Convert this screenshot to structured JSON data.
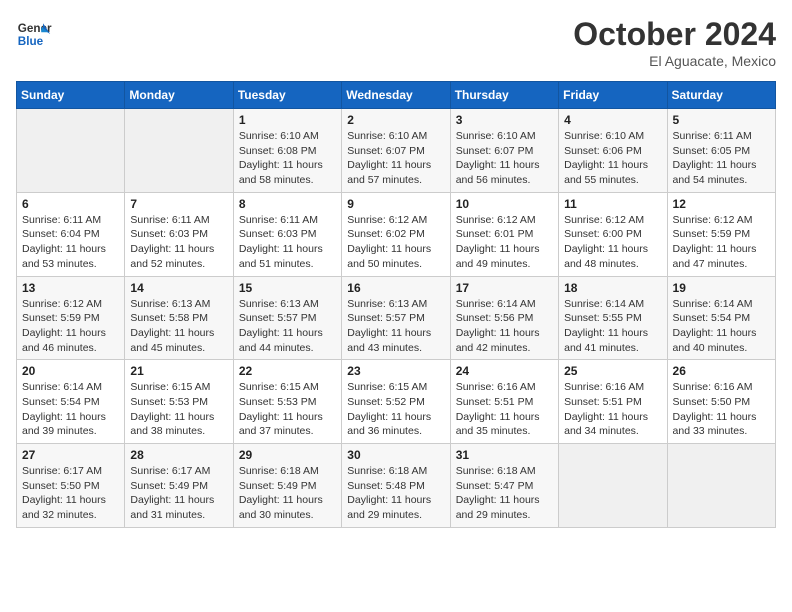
{
  "header": {
    "logo_line1": "General",
    "logo_line2": "Blue",
    "month": "October 2024",
    "location": "El Aguacate, Mexico"
  },
  "weekdays": [
    "Sunday",
    "Monday",
    "Tuesday",
    "Wednesday",
    "Thursday",
    "Friday",
    "Saturday"
  ],
  "weeks": [
    [
      {
        "day": "",
        "sunrise": "",
        "sunset": "",
        "daylight": ""
      },
      {
        "day": "",
        "sunrise": "",
        "sunset": "",
        "daylight": ""
      },
      {
        "day": "1",
        "sunrise": "Sunrise: 6:10 AM",
        "sunset": "Sunset: 6:08 PM",
        "daylight": "Daylight: 11 hours and 58 minutes."
      },
      {
        "day": "2",
        "sunrise": "Sunrise: 6:10 AM",
        "sunset": "Sunset: 6:07 PM",
        "daylight": "Daylight: 11 hours and 57 minutes."
      },
      {
        "day": "3",
        "sunrise": "Sunrise: 6:10 AM",
        "sunset": "Sunset: 6:07 PM",
        "daylight": "Daylight: 11 hours and 56 minutes."
      },
      {
        "day": "4",
        "sunrise": "Sunrise: 6:10 AM",
        "sunset": "Sunset: 6:06 PM",
        "daylight": "Daylight: 11 hours and 55 minutes."
      },
      {
        "day": "5",
        "sunrise": "Sunrise: 6:11 AM",
        "sunset": "Sunset: 6:05 PM",
        "daylight": "Daylight: 11 hours and 54 minutes."
      }
    ],
    [
      {
        "day": "6",
        "sunrise": "Sunrise: 6:11 AM",
        "sunset": "Sunset: 6:04 PM",
        "daylight": "Daylight: 11 hours and 53 minutes."
      },
      {
        "day": "7",
        "sunrise": "Sunrise: 6:11 AM",
        "sunset": "Sunset: 6:03 PM",
        "daylight": "Daylight: 11 hours and 52 minutes."
      },
      {
        "day": "8",
        "sunrise": "Sunrise: 6:11 AM",
        "sunset": "Sunset: 6:03 PM",
        "daylight": "Daylight: 11 hours and 51 minutes."
      },
      {
        "day": "9",
        "sunrise": "Sunrise: 6:12 AM",
        "sunset": "Sunset: 6:02 PM",
        "daylight": "Daylight: 11 hours and 50 minutes."
      },
      {
        "day": "10",
        "sunrise": "Sunrise: 6:12 AM",
        "sunset": "Sunset: 6:01 PM",
        "daylight": "Daylight: 11 hours and 49 minutes."
      },
      {
        "day": "11",
        "sunrise": "Sunrise: 6:12 AM",
        "sunset": "Sunset: 6:00 PM",
        "daylight": "Daylight: 11 hours and 48 minutes."
      },
      {
        "day": "12",
        "sunrise": "Sunrise: 6:12 AM",
        "sunset": "Sunset: 5:59 PM",
        "daylight": "Daylight: 11 hours and 47 minutes."
      }
    ],
    [
      {
        "day": "13",
        "sunrise": "Sunrise: 6:12 AM",
        "sunset": "Sunset: 5:59 PM",
        "daylight": "Daylight: 11 hours and 46 minutes."
      },
      {
        "day": "14",
        "sunrise": "Sunrise: 6:13 AM",
        "sunset": "Sunset: 5:58 PM",
        "daylight": "Daylight: 11 hours and 45 minutes."
      },
      {
        "day": "15",
        "sunrise": "Sunrise: 6:13 AM",
        "sunset": "Sunset: 5:57 PM",
        "daylight": "Daylight: 11 hours and 44 minutes."
      },
      {
        "day": "16",
        "sunrise": "Sunrise: 6:13 AM",
        "sunset": "Sunset: 5:57 PM",
        "daylight": "Daylight: 11 hours and 43 minutes."
      },
      {
        "day": "17",
        "sunrise": "Sunrise: 6:14 AM",
        "sunset": "Sunset: 5:56 PM",
        "daylight": "Daylight: 11 hours and 42 minutes."
      },
      {
        "day": "18",
        "sunrise": "Sunrise: 6:14 AM",
        "sunset": "Sunset: 5:55 PM",
        "daylight": "Daylight: 11 hours and 41 minutes."
      },
      {
        "day": "19",
        "sunrise": "Sunrise: 6:14 AM",
        "sunset": "Sunset: 5:54 PM",
        "daylight": "Daylight: 11 hours and 40 minutes."
      }
    ],
    [
      {
        "day": "20",
        "sunrise": "Sunrise: 6:14 AM",
        "sunset": "Sunset: 5:54 PM",
        "daylight": "Daylight: 11 hours and 39 minutes."
      },
      {
        "day": "21",
        "sunrise": "Sunrise: 6:15 AM",
        "sunset": "Sunset: 5:53 PM",
        "daylight": "Daylight: 11 hours and 38 minutes."
      },
      {
        "day": "22",
        "sunrise": "Sunrise: 6:15 AM",
        "sunset": "Sunset: 5:53 PM",
        "daylight": "Daylight: 11 hours and 37 minutes."
      },
      {
        "day": "23",
        "sunrise": "Sunrise: 6:15 AM",
        "sunset": "Sunset: 5:52 PM",
        "daylight": "Daylight: 11 hours and 36 minutes."
      },
      {
        "day": "24",
        "sunrise": "Sunrise: 6:16 AM",
        "sunset": "Sunset: 5:51 PM",
        "daylight": "Daylight: 11 hours and 35 minutes."
      },
      {
        "day": "25",
        "sunrise": "Sunrise: 6:16 AM",
        "sunset": "Sunset: 5:51 PM",
        "daylight": "Daylight: 11 hours and 34 minutes."
      },
      {
        "day": "26",
        "sunrise": "Sunrise: 6:16 AM",
        "sunset": "Sunset: 5:50 PM",
        "daylight": "Daylight: 11 hours and 33 minutes."
      }
    ],
    [
      {
        "day": "27",
        "sunrise": "Sunrise: 6:17 AM",
        "sunset": "Sunset: 5:50 PM",
        "daylight": "Daylight: 11 hours and 32 minutes."
      },
      {
        "day": "28",
        "sunrise": "Sunrise: 6:17 AM",
        "sunset": "Sunset: 5:49 PM",
        "daylight": "Daylight: 11 hours and 31 minutes."
      },
      {
        "day": "29",
        "sunrise": "Sunrise: 6:18 AM",
        "sunset": "Sunset: 5:49 PM",
        "daylight": "Daylight: 11 hours and 30 minutes."
      },
      {
        "day": "30",
        "sunrise": "Sunrise: 6:18 AM",
        "sunset": "Sunset: 5:48 PM",
        "daylight": "Daylight: 11 hours and 29 minutes."
      },
      {
        "day": "31",
        "sunrise": "Sunrise: 6:18 AM",
        "sunset": "Sunset: 5:47 PM",
        "daylight": "Daylight: 11 hours and 29 minutes."
      },
      {
        "day": "",
        "sunrise": "",
        "sunset": "",
        "daylight": ""
      },
      {
        "day": "",
        "sunrise": "",
        "sunset": "",
        "daylight": ""
      }
    ]
  ]
}
